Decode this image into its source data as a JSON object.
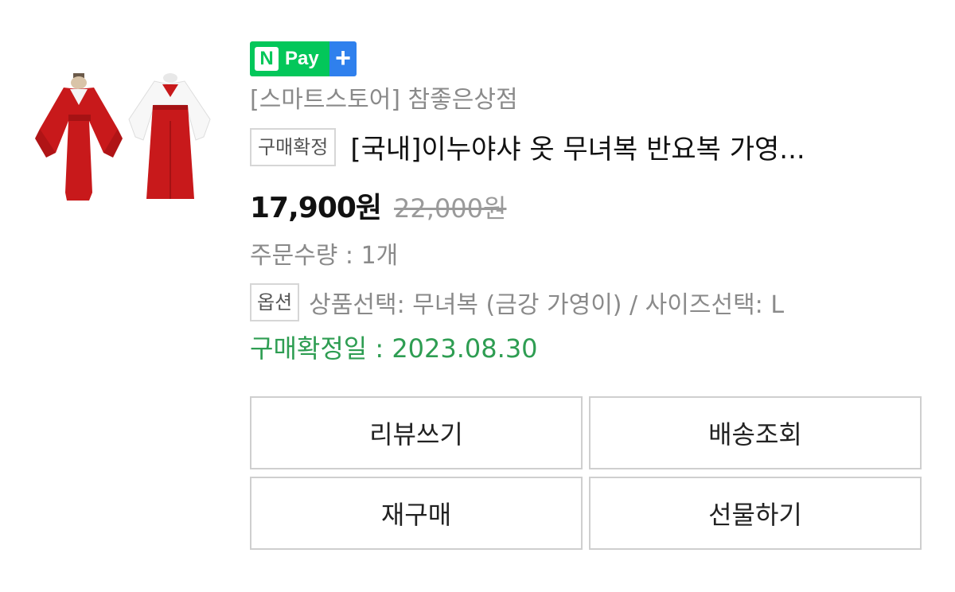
{
  "product": {
    "thumbnail_icon": "kimono-costume-image",
    "npay_badge": {
      "n_letter": "N",
      "pay_label": "Pay",
      "plus_symbol": "+"
    },
    "store_name": "[스마트스토어] 참좋은상점",
    "status_tag": "구매확정",
    "title": "[국내]이누야샤 옷 무녀복 반요복 가영...",
    "price": "17,900원",
    "original_price": "22,000원",
    "quantity": "주문수량 : 1개",
    "option_tag": "옵션",
    "option_text": "상품선택: 무녀복 (금강 가영이) / 사이즈선택: L",
    "confirm_date": "구매확정일 : 2023.08.30"
  },
  "actions": {
    "review_label": "리뷰쓰기",
    "track_label": "배송조회",
    "rebuy_label": "재구매",
    "gift_label": "선물하기"
  },
  "colors": {
    "npay_green": "#03c75a",
    "plus_blue": "#2f80ed",
    "confirm_green": "#2e9d52",
    "costume_red": "#c8191b"
  }
}
